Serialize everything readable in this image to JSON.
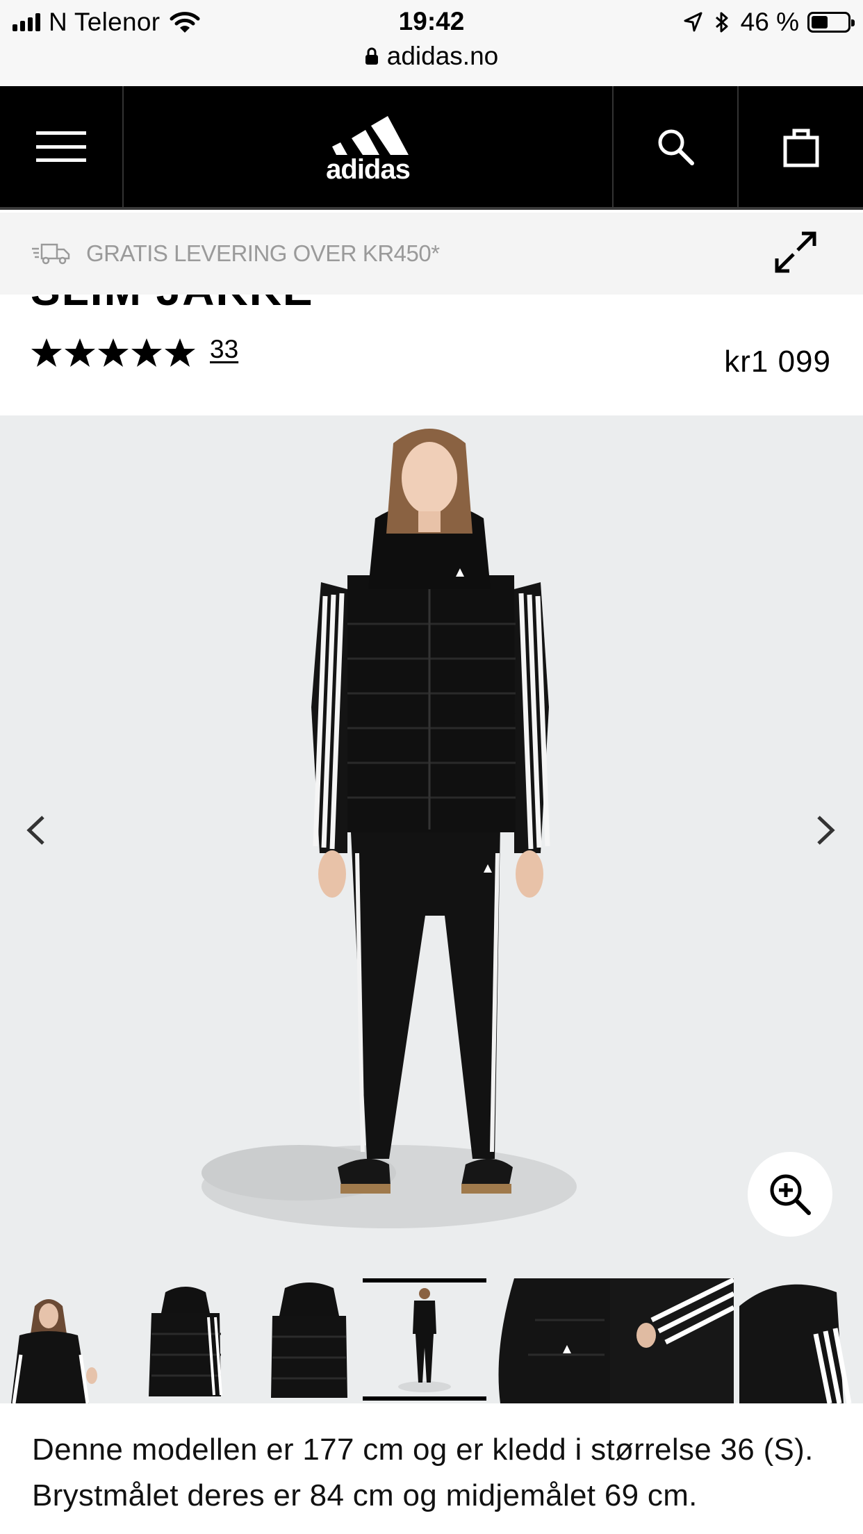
{
  "status_bar": {
    "carrier": "N Telenor",
    "time": "19:42",
    "battery_percent": "46 %",
    "battery_level": 0.46,
    "url": "adidas.no",
    "icons": [
      "signal-icon",
      "wifi-icon",
      "location-icon",
      "bluetooth-icon",
      "battery-icon",
      "lock-icon"
    ]
  },
  "header": {
    "logo_text": "adidas",
    "icons": [
      "hamburger-menu-icon",
      "adidas-logo",
      "search-icon",
      "shopping-bag-icon"
    ]
  },
  "banner": {
    "text": "GRATIS LEVERING OVER KR450*",
    "icons": [
      "delivery-truck-icon",
      "expand-icon"
    ]
  },
  "product": {
    "title_partial": "SLIM JAKKE",
    "rating": 5,
    "review_count": "33",
    "price": "kr1 099"
  },
  "gallery": {
    "thumbnail_count": 7,
    "active_thumbnail": 4,
    "icons": [
      "chevron-left-icon",
      "chevron-right-icon",
      "zoom-in-icon"
    ]
  },
  "description": {
    "text": "Denne modellen er 177 cm og er kledd i størrelse 36 (S). Brystmålet deres er 84 cm og midjemålet 69 cm."
  },
  "colors": {
    "header_bg": "#000000",
    "banner_bg": "#f4f4f4",
    "banner_text": "#9a9a9a",
    "image_bg": "#ebedee"
  }
}
